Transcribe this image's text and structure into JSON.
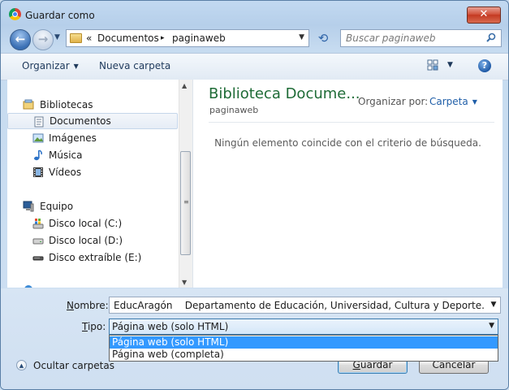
{
  "window": {
    "title": "Guardar como",
    "close_glyph": "✕",
    "icon": "chrome-icon"
  },
  "nav": {
    "back_glyph": "←",
    "forward_glyph": "→",
    "breadcrumb_sep": "«",
    "crumbs": [
      "Documentos",
      "paginaweb"
    ],
    "crumb_arrow": "▸",
    "search_placeholder": "Buscar paginaweb"
  },
  "toolbar": {
    "organize_label": "Organizar",
    "new_folder_label": "Nueva carpeta"
  },
  "sidebar": {
    "libraries_label": "Bibliotecas",
    "items": [
      {
        "label": "Documentos",
        "icon": "documents-icon",
        "selected": true
      },
      {
        "label": "Imágenes",
        "icon": "pictures-icon"
      },
      {
        "label": "Música",
        "icon": "music-icon"
      },
      {
        "label": "Vídeos",
        "icon": "videos-icon"
      }
    ],
    "computer_label": "Equipo",
    "drives": [
      {
        "label": "Disco local (C:)",
        "icon": "system-drive-icon"
      },
      {
        "label": "Disco local (D:)",
        "icon": "drive-icon"
      },
      {
        "label": "Disco extraíble (E:)",
        "icon": "removable-drive-icon"
      }
    ]
  },
  "content": {
    "library_title": "Biblioteca Docume...",
    "library_subtitle": "paginaweb",
    "arrange_label": "Organizar por:",
    "arrange_value": "Carpeta",
    "empty_message": "Ningún elemento coincide con el criterio de búsqueda."
  },
  "form": {
    "name_label_prefix": "N",
    "name_label_rest": "ombre:",
    "name_value": "EducAragón    Departamento de Educación, Universidad, Cultura y Deporte. Gobierno",
    "type_label_prefix": "T",
    "type_label_rest": "ipo:",
    "type_value": "Página web (solo HTML)",
    "type_options": [
      "Página web (solo HTML)",
      "Página web (completa)"
    ],
    "selected_option_index": 0
  },
  "footer": {
    "hide_folders_label": "Ocultar carpetas",
    "save_label_prefix": "G",
    "save_label_rest": "uardar",
    "cancel_label": "Cancelar"
  },
  "colors": {
    "accent": "#3399ff",
    "library_title": "#1e6b36",
    "link": "#1f5ea8"
  }
}
